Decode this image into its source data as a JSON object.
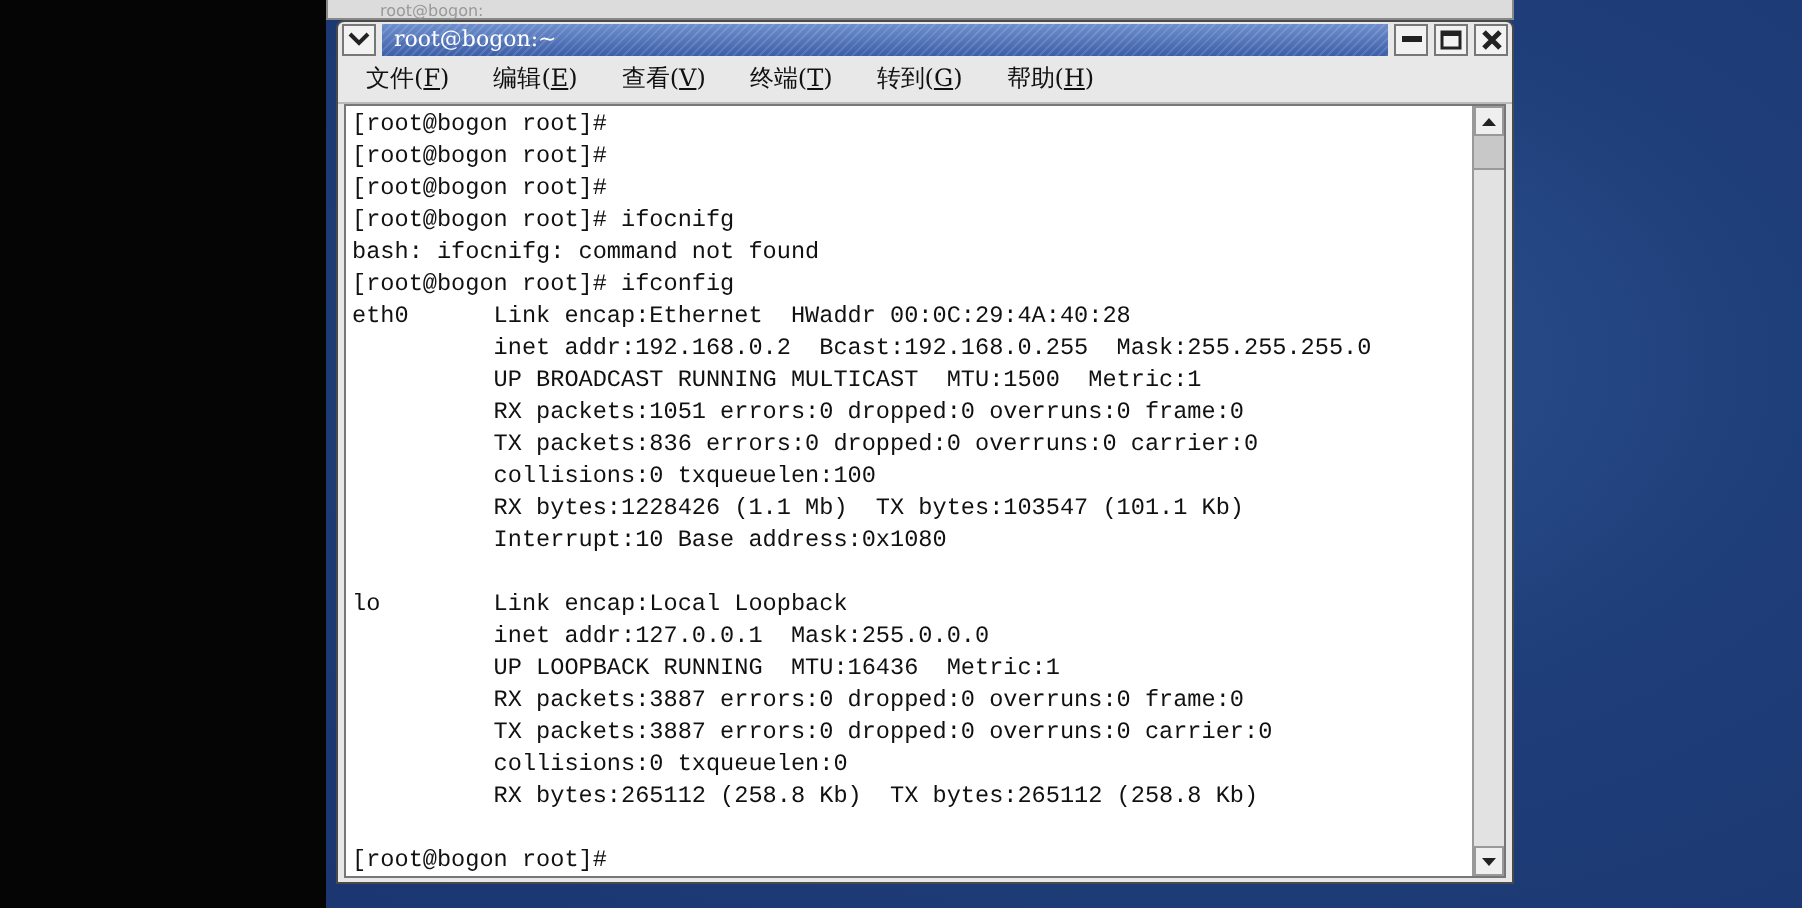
{
  "background_window": {
    "title": "root@bogon:"
  },
  "window": {
    "title": "root@bogon:~"
  },
  "menu": [
    {
      "before": "文件(",
      "mnemonic": "F",
      "after": ")"
    },
    {
      "before": "编辑(",
      "mnemonic": "E",
      "after": ")"
    },
    {
      "before": "查看(",
      "mnemonic": "V",
      "after": ")"
    },
    {
      "before": "终端(",
      "mnemonic": "T",
      "after": ")"
    },
    {
      "before": "转到(",
      "mnemonic": "G",
      "after": ")"
    },
    {
      "before": "帮助(",
      "mnemonic": "H",
      "after": ")"
    }
  ],
  "terminal_lines": [
    {
      "kind": "text",
      "text": "[root@bogon root]#"
    },
    {
      "kind": "text",
      "text": "[root@bogon root]#"
    },
    {
      "kind": "text",
      "text": "[root@bogon root]#"
    },
    {
      "kind": "text",
      "text": "[root@bogon root]# ifocnifg"
    },
    {
      "kind": "text",
      "text": "bash: ifocnifg: command not found"
    },
    {
      "kind": "text",
      "text": "[root@bogon root]# ifconfig"
    },
    {
      "kind": "text",
      "text": "eth0      Link encap:Ethernet  HWaddr 00:0C:29:4A:40:28"
    },
    {
      "kind": "text",
      "text": "          inet addr:192.168.0.2  Bcast:192.168.0.255  Mask:255.255.255.0"
    },
    {
      "kind": "text",
      "text": "          UP BROADCAST RUNNING MULTICAST  MTU:1500  Metric:1"
    },
    {
      "kind": "text",
      "text": "          RX packets:1051 errors:0 dropped:0 overruns:0 frame:0"
    },
    {
      "kind": "text",
      "text": "          TX packets:836 errors:0 dropped:0 overruns:0 carrier:0"
    },
    {
      "kind": "text",
      "text": "          collisions:0 txqueuelen:100"
    },
    {
      "kind": "text",
      "text": "          RX bytes:1228426 (1.1 Mb)  TX bytes:103547 (101.1 Kb)"
    },
    {
      "kind": "text",
      "text": "          Interrupt:10 Base address:0x1080"
    },
    {
      "kind": "blank"
    },
    {
      "kind": "text",
      "text": "lo        Link encap:Local Loopback"
    },
    {
      "kind": "text",
      "text": "          inet addr:127.0.0.1  Mask:255.0.0.0"
    },
    {
      "kind": "text",
      "text": "          UP LOOPBACK RUNNING  MTU:16436  Metric:1"
    },
    {
      "kind": "text",
      "text": "          RX packets:3887 errors:0 dropped:0 overruns:0 frame:0"
    },
    {
      "kind": "text",
      "text": "          TX packets:3887 errors:0 dropped:0 overruns:0 carrier:0"
    },
    {
      "kind": "text",
      "text": "          collisions:0 txqueuelen:0"
    },
    {
      "kind": "text",
      "text": "          RX bytes:265112 (258.8 Kb)  TX bytes:265112 (258.8 Kb)"
    },
    {
      "kind": "blank"
    },
    {
      "kind": "text",
      "text": "[root@bogon root]#"
    }
  ]
}
